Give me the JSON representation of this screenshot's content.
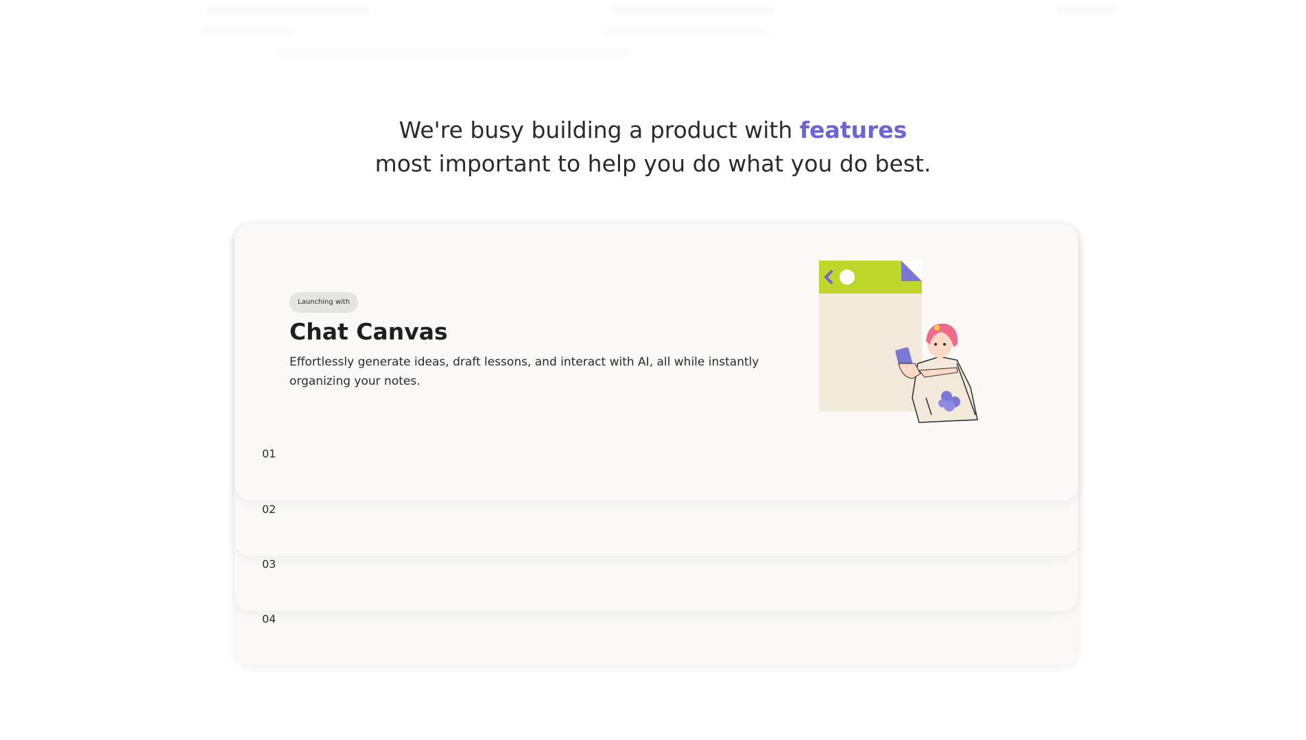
{
  "headline": {
    "line1_prefix": "We're busy building a product with ",
    "line1_accent": "features",
    "line2": "most important to help you do what you do best."
  },
  "colors": {
    "accent": "#6b63d6",
    "card_bg": "#faf9f8",
    "badge_bg": "#e3e5e0",
    "illustration_green": "#bfd62a",
    "illustration_panel": "#f2e9db",
    "illustration_purple": "#7b77d6",
    "illustration_pink": "#f06a8c"
  },
  "feature": {
    "badge": "Launching with",
    "title": "Chat Canvas",
    "description": "Effortlessly generate ideas, draft lessons, and interact with AI, all while instantly organizing your notes.",
    "illustration": "chat-canvas-illustration"
  },
  "cards": [
    {
      "number": "01"
    },
    {
      "number": "02"
    },
    {
      "number": "03"
    },
    {
      "number": "04"
    }
  ]
}
